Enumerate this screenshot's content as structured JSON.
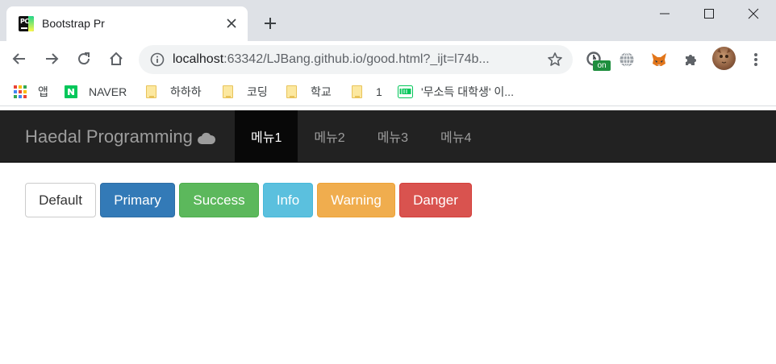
{
  "browser": {
    "tab_title": "Bootstrap Pr",
    "favicon_text": "PC",
    "url_host": "localhost",
    "url_rest": ":63342/LJBang.github.io/good.html?_ijt=l74b...",
    "ext_badge": "on",
    "bookmarks": [
      {
        "label": "앱",
        "icon": "apps-grid-icon"
      },
      {
        "label": "NAVER",
        "icon": "naver-icon"
      },
      {
        "label": "하하하",
        "icon": "folder-icon"
      },
      {
        "label": "코딩",
        "icon": "folder-icon"
      },
      {
        "label": "학교",
        "icon": "folder-icon"
      },
      {
        "label": "1",
        "icon": "folder-icon"
      },
      {
        "label": "'무소득 대학생' 이...",
        "icon": "blog-icon"
      }
    ]
  },
  "page": {
    "brand": "Haedal Programming",
    "brand_icon": "cloud-icon",
    "menu": [
      {
        "label": "메뉴1",
        "active": true
      },
      {
        "label": "메뉴2",
        "active": false
      },
      {
        "label": "메뉴3",
        "active": false
      },
      {
        "label": "메뉴4",
        "active": false
      }
    ],
    "buttons": [
      {
        "label": "Default",
        "color": "#ffffff"
      },
      {
        "label": "Primary",
        "color": "#337ab7"
      },
      {
        "label": "Success",
        "color": "#5cb85c"
      },
      {
        "label": "Info",
        "color": "#5bc0de"
      },
      {
        "label": "Warning",
        "color": "#f0ad4e"
      },
      {
        "label": "Danger",
        "color": "#d9534f"
      }
    ]
  }
}
